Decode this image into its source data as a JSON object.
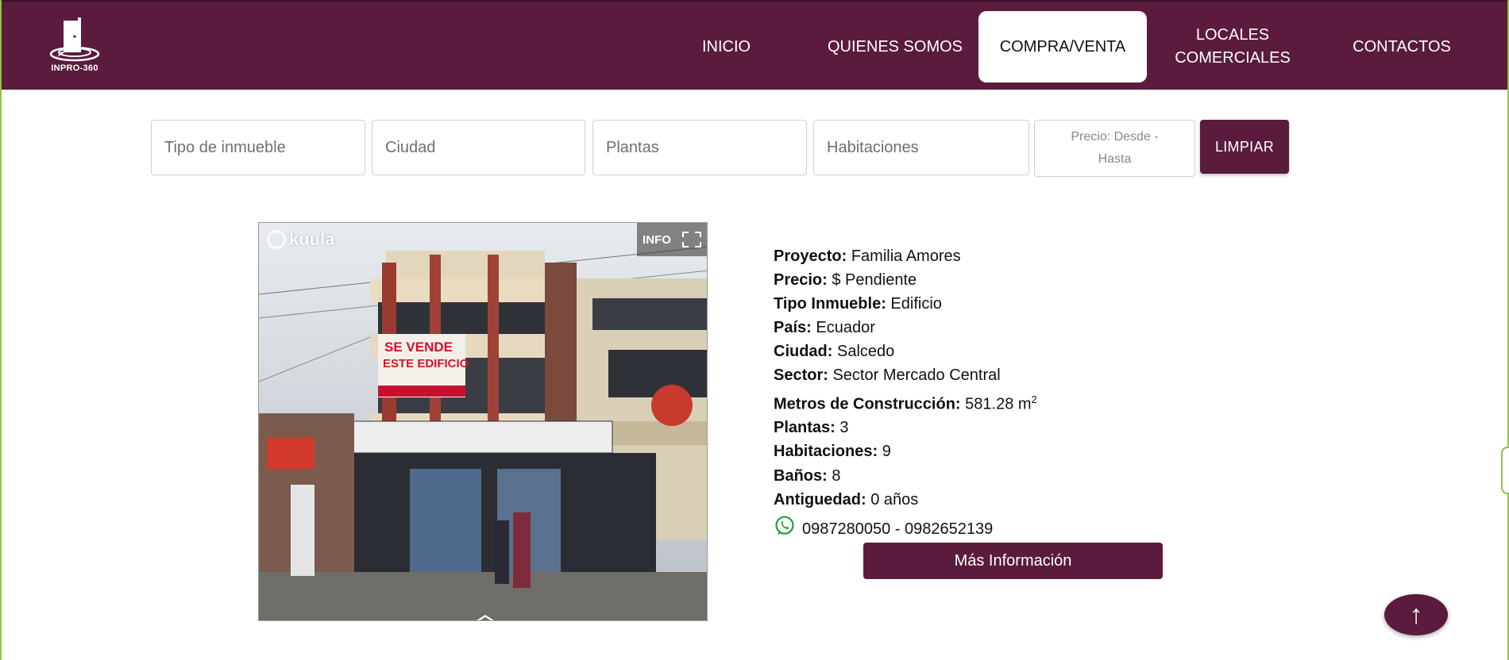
{
  "brand": {
    "logo_text": "INPRO-360"
  },
  "nav": {
    "items": [
      {
        "label": "INICIO"
      },
      {
        "label": "QUIENES SOMOS"
      },
      {
        "label": "COMPRA/VENTA"
      },
      {
        "label": "LOCALES COMERCIALES"
      },
      {
        "label": "CONTACTOS"
      }
    ],
    "active": "COMPRA/VENTA"
  },
  "filters": {
    "tipo_placeholder": "Tipo de inmueble",
    "ciudad_placeholder": "Ciudad",
    "plantas_placeholder": "Plantas",
    "habitaciones_placeholder": "Habitaciones",
    "precio_placeholder": "Precio: Desde - Hasta",
    "clear_label": "LIMPIAR"
  },
  "viewer": {
    "brand": "kuula",
    "info_label": "INFO",
    "sign_text": "SE VENDE ESTE EDIFICIO"
  },
  "property": {
    "proyecto_label": "Proyecto:",
    "proyecto": "Familia Amores",
    "precio_label": "Precio:",
    "precio": "$ Pendiente",
    "tipo_label": "Tipo Inmueble:",
    "tipo": "Edificio",
    "pais_label": "País:",
    "pais": "Ecuador",
    "ciudad_label": "Ciudad:",
    "ciudad": "Salcedo",
    "sector_label": "Sector:",
    "sector": "Sector Mercado Central",
    "metros_label": "Metros de Construcción:",
    "metros": "581.28 m",
    "metros_unit_sup": "2",
    "plantas_label": "Plantas:",
    "plantas": "3",
    "habitaciones_label": "Habitaciones:",
    "habitaciones": "9",
    "banos_label": "Baños:",
    "banos": "8",
    "antiguedad_label": "Antiguedad:",
    "antiguedad": "0 años",
    "telefono": "0987280050 - 0982652139",
    "more_label": "Más Información"
  },
  "scroll_top": {
    "label": "↑"
  },
  "colors": {
    "brand": "#5a1b3d",
    "accent_green": "#8cc63f",
    "whatsapp": "#25a244"
  },
  "icons": {
    "whatsapp": "whatsapp-icon",
    "fullscreen": "fullscreen-icon",
    "scroll_top": "arrow-up-icon"
  }
}
